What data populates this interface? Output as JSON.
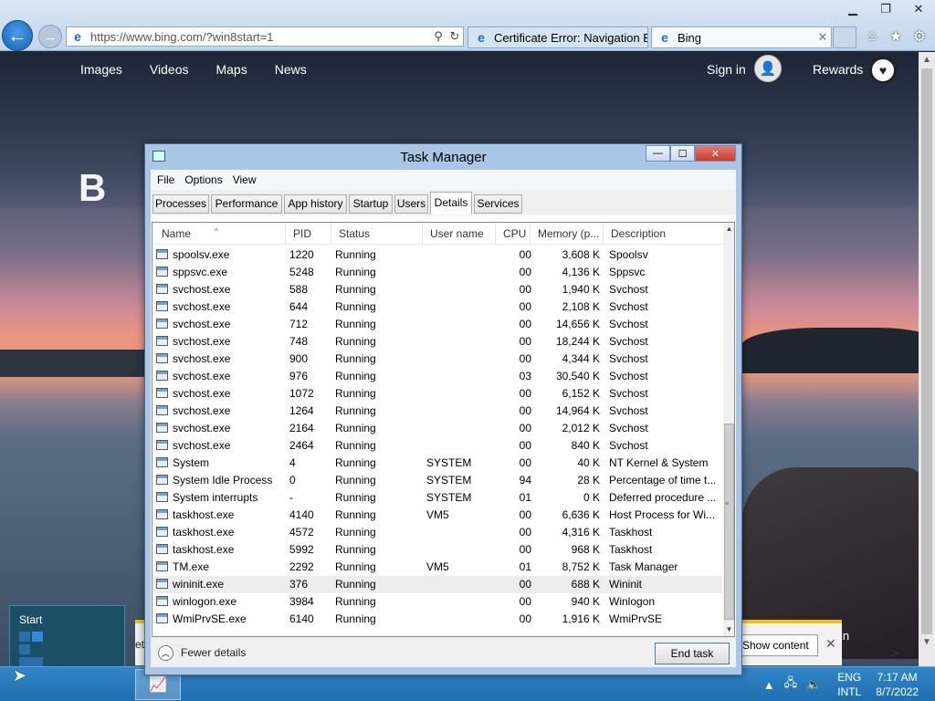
{
  "browser": {
    "url": "https://www.bing.com/?win8start=1",
    "tabs": [
      {
        "label": "Certificate Error: Navigation Bl..."
      },
      {
        "label": "Bing"
      }
    ],
    "window_controls": {
      "minimize": "▁",
      "restore": "❐",
      "close": "✕"
    },
    "back_icon": "←",
    "forward_icon": "→",
    "address_buttons": {
      "search": "⚲",
      "refresh": "↻"
    },
    "toolbar_icons": {
      "home": "⌂",
      "favorites": "★",
      "settings": "⚙"
    }
  },
  "bing": {
    "nav": [
      "Images",
      "Videos",
      "Maps",
      "News"
    ],
    "sign_in": "Sign in",
    "rewards": "Rewards",
    "logo_text": "B",
    "notification": {
      "left_text": "et",
      "button_label": "Show content",
      "right_text": "in"
    }
  },
  "task_manager": {
    "title": "Task Manager",
    "controls": {
      "minimize": "—",
      "maximize": "☐",
      "close": "✕"
    },
    "menu": [
      "File",
      "Options",
      "View"
    ],
    "tabs": [
      "Processes",
      "Performance",
      "App history",
      "Startup",
      "Users",
      "Details",
      "Services"
    ],
    "active_tab": "Details",
    "columns": {
      "name": "Name",
      "pid": "PID",
      "status": "Status",
      "user": "User name",
      "cpu": "CPU",
      "memory": "Memory (p...",
      "description": "Description"
    },
    "sort_indicator": "^",
    "rows": [
      {
        "name": "spoolsv.exe",
        "pid": "1220",
        "status": "Running",
        "user": "",
        "cpu": "00",
        "memory": "3,608 K",
        "description": "Spoolsv"
      },
      {
        "name": "sppsvc.exe",
        "pid": "5248",
        "status": "Running",
        "user": "",
        "cpu": "00",
        "memory": "4,136 K",
        "description": "Sppsvc"
      },
      {
        "name": "svchost.exe",
        "pid": "588",
        "status": "Running",
        "user": "",
        "cpu": "00",
        "memory": "1,940 K",
        "description": "Svchost"
      },
      {
        "name": "svchost.exe",
        "pid": "644",
        "status": "Running",
        "user": "",
        "cpu": "00",
        "memory": "2,108 K",
        "description": "Svchost"
      },
      {
        "name": "svchost.exe",
        "pid": "712",
        "status": "Running",
        "user": "",
        "cpu": "00",
        "memory": "14,656 K",
        "description": "Svchost"
      },
      {
        "name": "svchost.exe",
        "pid": "748",
        "status": "Running",
        "user": "",
        "cpu": "00",
        "memory": "18,244 K",
        "description": "Svchost"
      },
      {
        "name": "svchost.exe",
        "pid": "900",
        "status": "Running",
        "user": "",
        "cpu": "00",
        "memory": "4,344 K",
        "description": "Svchost"
      },
      {
        "name": "svchost.exe",
        "pid": "976",
        "status": "Running",
        "user": "",
        "cpu": "03",
        "memory": "30,540 K",
        "description": "Svchost"
      },
      {
        "name": "svchost.exe",
        "pid": "1072",
        "status": "Running",
        "user": "",
        "cpu": "00",
        "memory": "6,152 K",
        "description": "Svchost"
      },
      {
        "name": "svchost.exe",
        "pid": "1264",
        "status": "Running",
        "user": "",
        "cpu": "00",
        "memory": "14,964 K",
        "description": "Svchost"
      },
      {
        "name": "svchost.exe",
        "pid": "2164",
        "status": "Running",
        "user": "",
        "cpu": "00",
        "memory": "2,012 K",
        "description": "Svchost"
      },
      {
        "name": "svchost.exe",
        "pid": "2464",
        "status": "Running",
        "user": "",
        "cpu": "00",
        "memory": "840 K",
        "description": "Svchost"
      },
      {
        "name": "System",
        "pid": "4",
        "status": "Running",
        "user": "SYSTEM",
        "cpu": "00",
        "memory": "40 K",
        "description": "NT Kernel & System"
      },
      {
        "name": "System Idle Process",
        "pid": "0",
        "status": "Running",
        "user": "SYSTEM",
        "cpu": "94",
        "memory": "28 K",
        "description": "Percentage of time t..."
      },
      {
        "name": "System interrupts",
        "pid": "-",
        "status": "Running",
        "user": "SYSTEM",
        "cpu": "01",
        "memory": "0 K",
        "description": "Deferred procedure ..."
      },
      {
        "name": "taskhost.exe",
        "pid": "4140",
        "status": "Running",
        "user": "VM5",
        "cpu": "00",
        "memory": "6,636 K",
        "description": "Host Process for Wi..."
      },
      {
        "name": "taskhost.exe",
        "pid": "4572",
        "status": "Running",
        "user": "",
        "cpu": "00",
        "memory": "4,316 K",
        "description": "Taskhost"
      },
      {
        "name": "taskhost.exe",
        "pid": "5992",
        "status": "Running",
        "user": "",
        "cpu": "00",
        "memory": "968 K",
        "description": "Taskhost"
      },
      {
        "name": "TM.exe",
        "pid": "2292",
        "status": "Running",
        "user": "VM5",
        "cpu": "01",
        "memory": "8,752 K",
        "description": "Task Manager"
      },
      {
        "name": "wininit.exe",
        "pid": "376",
        "status": "Running",
        "user": "",
        "cpu": "00",
        "memory": "688 K",
        "description": "Wininit"
      },
      {
        "name": "winlogon.exe",
        "pid": "3984",
        "status": "Running",
        "user": "",
        "cpu": "00",
        "memory": "940 K",
        "description": "Winlogon"
      },
      {
        "name": "WmiPrvSE.exe",
        "pid": "6140",
        "status": "Running",
        "user": "",
        "cpu": "00",
        "memory": "1,916 K",
        "description": "WmiPrvSE"
      }
    ],
    "selected_row": "wininit.exe",
    "fewer_details": "Fewer details",
    "end_task": "End task"
  },
  "start": {
    "label": "Start"
  },
  "taskbar": {
    "language": "ENG",
    "layout": "INTL",
    "time": "7:17 AM",
    "date": "8/7/2022",
    "tray_icons": {
      "chevron": "▲",
      "network": "🖧",
      "volume": "🔈"
    }
  },
  "colors": {
    "accent": "#1f6fb0",
    "selection": "#ededed",
    "tm_frame": "#a9c6e6",
    "notification_border": "#f0c20f"
  }
}
